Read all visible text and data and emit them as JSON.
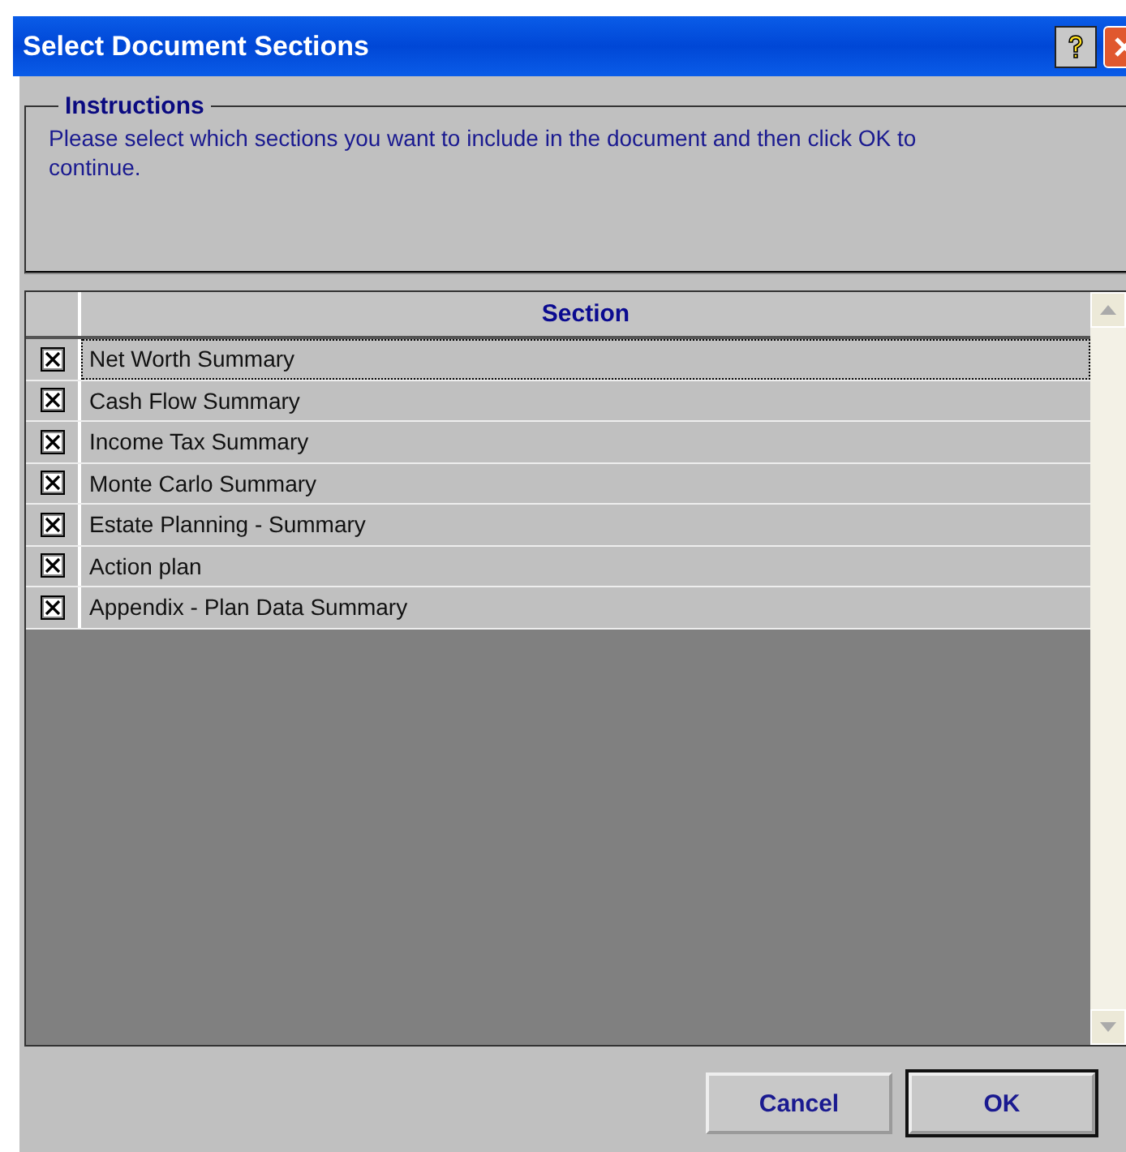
{
  "window": {
    "title": "Select Document Sections"
  },
  "instructions": {
    "legend": "Instructions",
    "text": "Please select which sections you want to include in the document and then click OK to continue."
  },
  "table": {
    "columns": [
      "Section"
    ],
    "rows": [
      {
        "label": "Net Worth Summary",
        "checked": true,
        "focused": true
      },
      {
        "label": "Cash Flow Summary",
        "checked": true,
        "focused": false
      },
      {
        "label": "Income Tax Summary",
        "checked": true,
        "focused": false
      },
      {
        "label": "Monte Carlo Summary",
        "checked": true,
        "focused": false
      },
      {
        "label": "Estate Planning - Summary",
        "checked": true,
        "focused": false
      },
      {
        "label": "Action plan",
        "checked": true,
        "focused": false
      },
      {
        "label": "Appendix - Plan Data Summary",
        "checked": true,
        "focused": false
      }
    ]
  },
  "buttons": [
    {
      "label": "Cancel",
      "default": false
    },
    {
      "label": "OK",
      "default": true
    }
  ]
}
